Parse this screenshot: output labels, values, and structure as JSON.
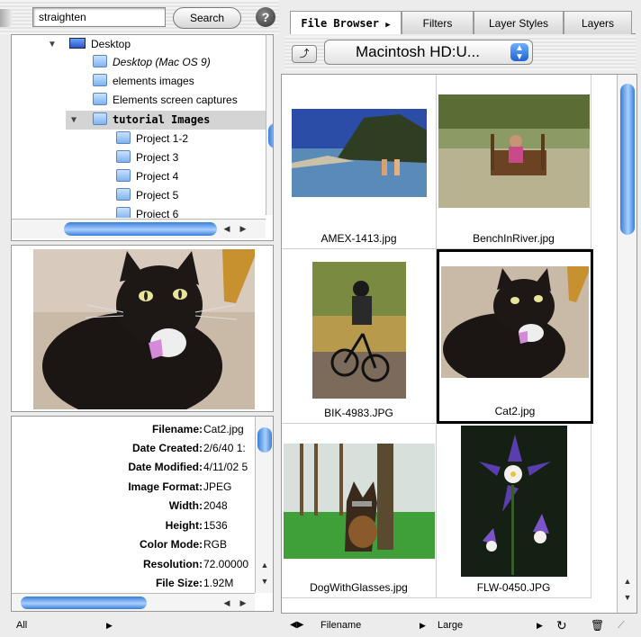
{
  "search": {
    "value": "straighten",
    "button_label": "Search",
    "help_label": "?"
  },
  "tree": {
    "items": [
      {
        "label": "Desktop",
        "icon": "desktop-icon",
        "italic": false,
        "bold": false,
        "expanded": true
      },
      {
        "label": "Desktop (Mac OS 9)",
        "icon": "folder-icon",
        "italic": true,
        "bold": false
      },
      {
        "label": "elements images",
        "icon": "folder-icon",
        "italic": false,
        "bold": false
      },
      {
        "label": "Elements screen captures",
        "icon": "folder-icon",
        "italic": false,
        "bold": false
      },
      {
        "label": "tutorial Images",
        "icon": "folder-icon",
        "italic": false,
        "bold": true,
        "expanded": true,
        "selected": true
      },
      {
        "label": "Project 1-2",
        "icon": "folder-icon"
      },
      {
        "label": "Project 3",
        "icon": "folder-icon"
      },
      {
        "label": "Project 4",
        "icon": "folder-icon"
      },
      {
        "label": "Project 5",
        "icon": "folder-icon"
      },
      {
        "label": "Project 6",
        "icon": "folder-icon"
      }
    ]
  },
  "metadata": [
    {
      "label": "Filename",
      "value": "Cat2.jpg"
    },
    {
      "label": "Date Created",
      "value": "2/6/40 1:"
    },
    {
      "label": "Date Modified",
      "value": "4/11/02 5"
    },
    {
      "label": "Image Format",
      "value": "JPEG"
    },
    {
      "label": "Width",
      "value": "2048"
    },
    {
      "label": "Height",
      "value": "1536"
    },
    {
      "label": "Color Mode",
      "value": "RGB"
    },
    {
      "label": "Resolution",
      "value": "72.00000"
    },
    {
      "label": "File Size",
      "value": "1.92M"
    }
  ],
  "left_footer": {
    "label": "All"
  },
  "tabs": [
    {
      "label": "File Browser",
      "active": true
    },
    {
      "label": "Filters",
      "active": false
    },
    {
      "label": "Layer Styles",
      "active": false
    },
    {
      "label": "Layers",
      "active": false
    }
  ],
  "path": {
    "label": "Macintosh HD:U..."
  },
  "files": [
    {
      "name": "AMEX-1413.jpg",
      "thumb": "beach-photo"
    },
    {
      "name": "BenchInRiver.jpg",
      "thumb": "river-photo"
    },
    {
      "name": "BIK-4983.JPG",
      "thumb": "bike-photo"
    },
    {
      "name": "Cat2.jpg",
      "thumb": "cat-photo",
      "selected": true
    },
    {
      "name": "DogWithGlasses.jpg",
      "thumb": "dog-photo"
    },
    {
      "name": "FLW-0450.JPG",
      "thumb": "flower-photo"
    }
  ],
  "right_footer": {
    "sort_label": "Filename",
    "size_label": "Large"
  },
  "colors": {
    "accent": "#3a7dd8",
    "panel_bg": "#ececec"
  }
}
